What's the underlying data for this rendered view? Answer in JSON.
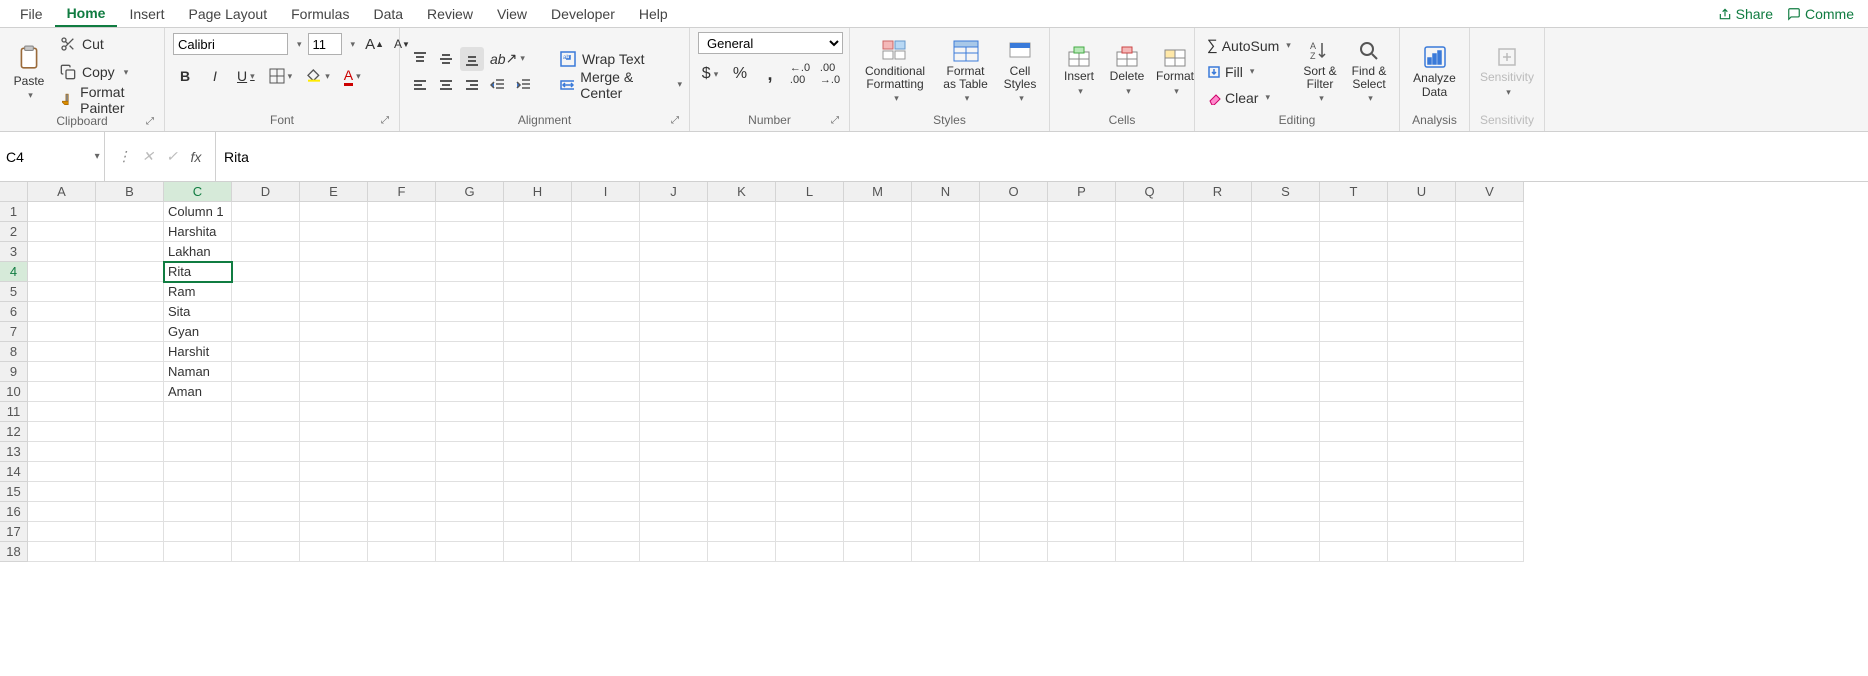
{
  "tabs": {
    "file": "File",
    "home": "Home",
    "insert": "Insert",
    "pageLayout": "Page Layout",
    "formulas": "Formulas",
    "data": "Data",
    "review": "Review",
    "view": "View",
    "developer": "Developer",
    "help": "Help",
    "share": "Share",
    "comments": "Comme"
  },
  "ribbon": {
    "clipboard": {
      "paste": "Paste",
      "cut": "Cut",
      "copy": "Copy",
      "formatPainter": "Format Painter",
      "label": "Clipboard"
    },
    "font": {
      "name": "Calibri",
      "size": "11",
      "label": "Font"
    },
    "alignment": {
      "wrap": "Wrap Text",
      "merge": "Merge & Center",
      "label": "Alignment"
    },
    "number": {
      "format": "General",
      "label": "Number"
    },
    "styles": {
      "conditional": "Conditional Formatting",
      "formatTable": "Format as Table",
      "cellStyles": "Cell Styles",
      "label": "Styles"
    },
    "cells": {
      "insert": "Insert",
      "delete": "Delete",
      "format": "Format",
      "label": "Cells"
    },
    "editing": {
      "autosum": "AutoSum",
      "fill": "Fill",
      "clear": "Clear",
      "sort": "Sort & Filter",
      "find": "Find & Select",
      "label": "Editing"
    },
    "analysis": {
      "analyze": "Analyze Data",
      "label": "Analysis"
    },
    "sensitivity": {
      "btn": "Sensitivity",
      "label": "Sensitivity"
    }
  },
  "formulaBar": {
    "cellRef": "C4",
    "value": "Rita",
    "fx": "fx"
  },
  "sheet": {
    "columns": [
      "A",
      "B",
      "C",
      "D",
      "E",
      "F",
      "G",
      "H",
      "I",
      "J",
      "K",
      "L",
      "M",
      "N",
      "O",
      "P",
      "Q",
      "R",
      "S",
      "T",
      "U",
      "V"
    ],
    "rowCount": 18,
    "selected": {
      "row": 4,
      "col": "C"
    },
    "data": {
      "C1": "Column 1",
      "C2": "Harshita",
      "C3": "Lakhan",
      "C4": "Rita",
      "C5": "Ram",
      "C6": "Sita",
      "C7": "Gyan",
      "C8": "Harshit",
      "C9": "Naman",
      "C10": "Aman"
    }
  }
}
